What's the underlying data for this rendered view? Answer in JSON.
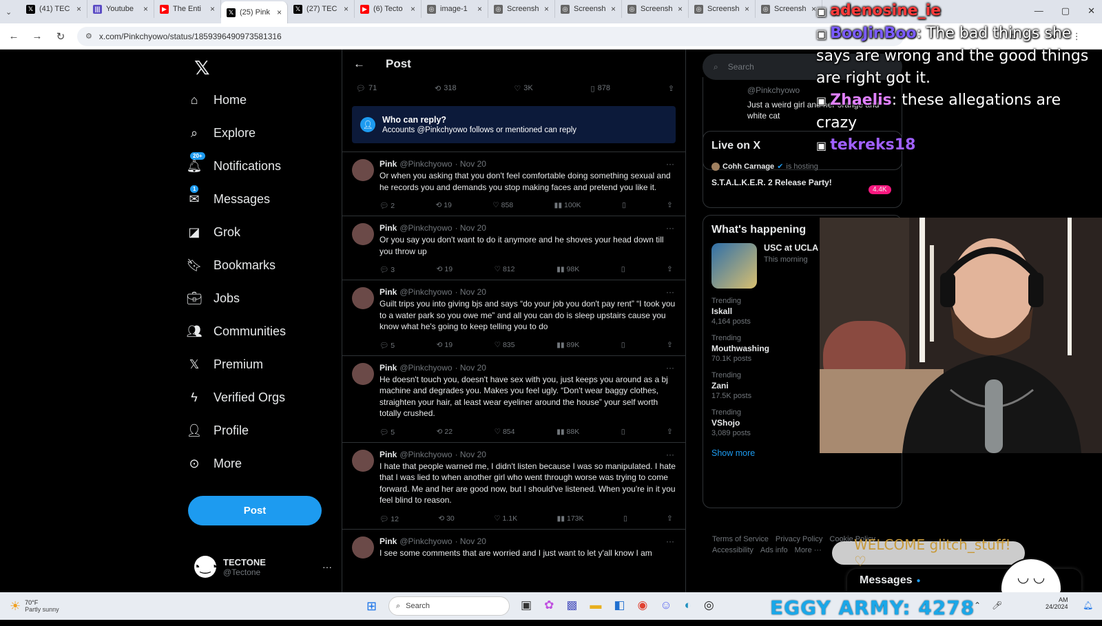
{
  "browser": {
    "tabs": [
      {
        "title": "(41) TEC",
        "color": "#000000",
        "icon": "x-logo-icon"
      },
      {
        "title": "Youtube",
        "color": "#5b4cc4",
        "icon": "bars-icon"
      },
      {
        "title": "The Enti",
        "color": "#ff0000",
        "icon": "youtube-icon"
      },
      {
        "title": "(25) Pink",
        "color": "#000000",
        "icon": "x-logo-icon",
        "active": true
      },
      {
        "title": "(27) TEC",
        "color": "#000000",
        "icon": "x-logo-icon"
      },
      {
        "title": "(6) Tecto",
        "color": "#ff0000",
        "icon": "youtube-icon"
      },
      {
        "title": "image-1",
        "color": "#666666",
        "icon": "globe-icon"
      },
      {
        "title": "Screensh",
        "color": "#666666",
        "icon": "globe-icon"
      },
      {
        "title": "Screensh",
        "color": "#666666",
        "icon": "globe-icon"
      },
      {
        "title": "Screensh",
        "color": "#666666",
        "icon": "globe-icon"
      },
      {
        "title": "Screensh",
        "color": "#666666",
        "icon": "globe-icon"
      },
      {
        "title": "Screensh",
        "color": "#666666",
        "icon": "globe-icon"
      }
    ],
    "url": "x.com/Pinkchyowo/status/1859396490973581316"
  },
  "nav": {
    "items": [
      {
        "label": "Home",
        "icon": "home-icon"
      },
      {
        "label": "Explore",
        "icon": "search-icon"
      },
      {
        "label": "Notifications",
        "icon": "bell-icon",
        "badge": "20+"
      },
      {
        "label": "Messages",
        "icon": "mail-icon",
        "badge": "1"
      },
      {
        "label": "Grok",
        "icon": "grok-icon"
      },
      {
        "label": "Bookmarks",
        "icon": "bookmark-icon"
      },
      {
        "label": "Jobs",
        "icon": "briefcase-icon"
      },
      {
        "label": "Communities",
        "icon": "people-icon"
      },
      {
        "label": "Premium",
        "icon": "x-logo-icon"
      },
      {
        "label": "Verified Orgs",
        "icon": "lightning-icon"
      },
      {
        "label": "Profile",
        "icon": "person-icon"
      },
      {
        "label": "More",
        "icon": "more-circle-icon"
      }
    ],
    "post_label": "Post",
    "account": {
      "name": "TECTONE",
      "handle": "@Tectone"
    }
  },
  "timeline": {
    "title": "Post",
    "main_stats": {
      "replies": "71",
      "reposts": "318",
      "likes": "3K",
      "bookmarks": "878"
    },
    "who_can_reply": {
      "title": "Who can reply?",
      "subtitle": "Accounts @Pinkchyowo follows or mentioned can reply"
    },
    "replies": [
      {
        "name": "Pink",
        "handle": "@Pinkchyowo",
        "date": "· Nov 20",
        "text": "Or when you asking that you don't feel comfortable doing something sexual and he records you and demands you stop making faces and pretend you like it.",
        "replies": "2",
        "reposts": "19",
        "likes": "858",
        "views": "100K"
      },
      {
        "name": "Pink",
        "handle": "@Pinkchyowo",
        "date": "· Nov 20",
        "text": "Or you say you don't want to do it anymore and he shoves your head down till you throw up",
        "replies": "3",
        "reposts": "19",
        "likes": "812",
        "views": "98K"
      },
      {
        "name": "Pink",
        "handle": "@Pinkchyowo",
        "date": "· Nov 20",
        "text": "Guilt trips you into giving bjs and says “do your job you don't pay rent” “I took you to a water park so you owe me” and all you can do is sleep upstairs cause you know what he's going to keep telling you to do",
        "replies": "5",
        "reposts": "19",
        "likes": "835",
        "views": "89K"
      },
      {
        "name": "Pink",
        "handle": "@Pinkchyowo",
        "date": "· Nov 20",
        "text": "He doesn't touch you, doesn't have sex with you, just keeps you around as a bj machine and degrades you. Makes you feel ugly. “Don't wear baggy clothes, straighten your hair, at least wear eyeliner around the house” your self worth totally crushed.",
        "replies": "5",
        "reposts": "22",
        "likes": "854",
        "views": "88K"
      },
      {
        "name": "Pink",
        "handle": "@Pinkchyowo",
        "date": "· Nov 20",
        "text": "I hate that people warned me, I didn't listen because I was so manipulated. I hate that I was lied to when another girl who went through worse was trying to come forward. Me and her are good now, but I should've listened. When you're in it you feel blind to reason.",
        "replies": "12",
        "reposts": "30",
        "likes": "1.1K",
        "views": "173K"
      },
      {
        "name": "Pink",
        "handle": "@Pinkchyowo",
        "date": "· Nov 20",
        "text": "I see some comments that are worried and I just want to let y'all know I am",
        "replies": "",
        "reposts": "",
        "likes": "",
        "views": ""
      }
    ]
  },
  "sidebar": {
    "search_placeholder": "Search",
    "profile_card": {
      "handle": "@Pinkchyowo",
      "bio": "Just a weird girl and her orange and white cat"
    },
    "live": {
      "title": "Live on X",
      "host": "Cohh Carnage",
      "hosting": "is hosting",
      "event": "S.T.A.L.K.E.R. 2 Release Party!",
      "count": "4.4K"
    },
    "happening": {
      "title": "What's happening",
      "feature": {
        "name": "USC at UCLA",
        "time": "This morning"
      },
      "trends": [
        {
          "label": "Trending",
          "name": "Iskall",
          "posts": "4,164 posts"
        },
        {
          "label": "Trending",
          "name": "Mouthwashing",
          "posts": "70.1K posts"
        },
        {
          "label": "Trending",
          "name": "Zani",
          "posts": "17.5K posts"
        },
        {
          "label": "Trending",
          "name": "VShojo",
          "posts": "3,089 posts"
        }
      ],
      "show_more": "Show more"
    },
    "footer": [
      "Terms of Service",
      "Privacy Policy",
      "Cookie Policy",
      "Accessibility",
      "Ads info",
      "More ···"
    ]
  },
  "stream": {
    "chat": [
      {
        "user": "adenosine_ie",
        "user_color": "#ff3b3b",
        "text": ""
      },
      {
        "user": "BooJinBoo",
        "user_color": "#7b5cff",
        "text": "The bad things she says are wrong and the good things are right got it."
      },
      {
        "user": "Zhaelis",
        "user_color": "#e080ff",
        "text": "these allegations are crazy"
      },
      {
        "user": "tekreks18",
        "user_color": "#a060ff",
        "text": ""
      }
    ],
    "welcome": "WELCOME glitch_stuff! ♡",
    "eggy": "EGGY ARMY: 4278",
    "dm_label": "Messages"
  },
  "taskbar": {
    "weather_temp": "70°F",
    "weather_desc": "Partly sunny",
    "search_placeholder": "Search",
    "clock": "AM",
    "date": "24/2024"
  }
}
